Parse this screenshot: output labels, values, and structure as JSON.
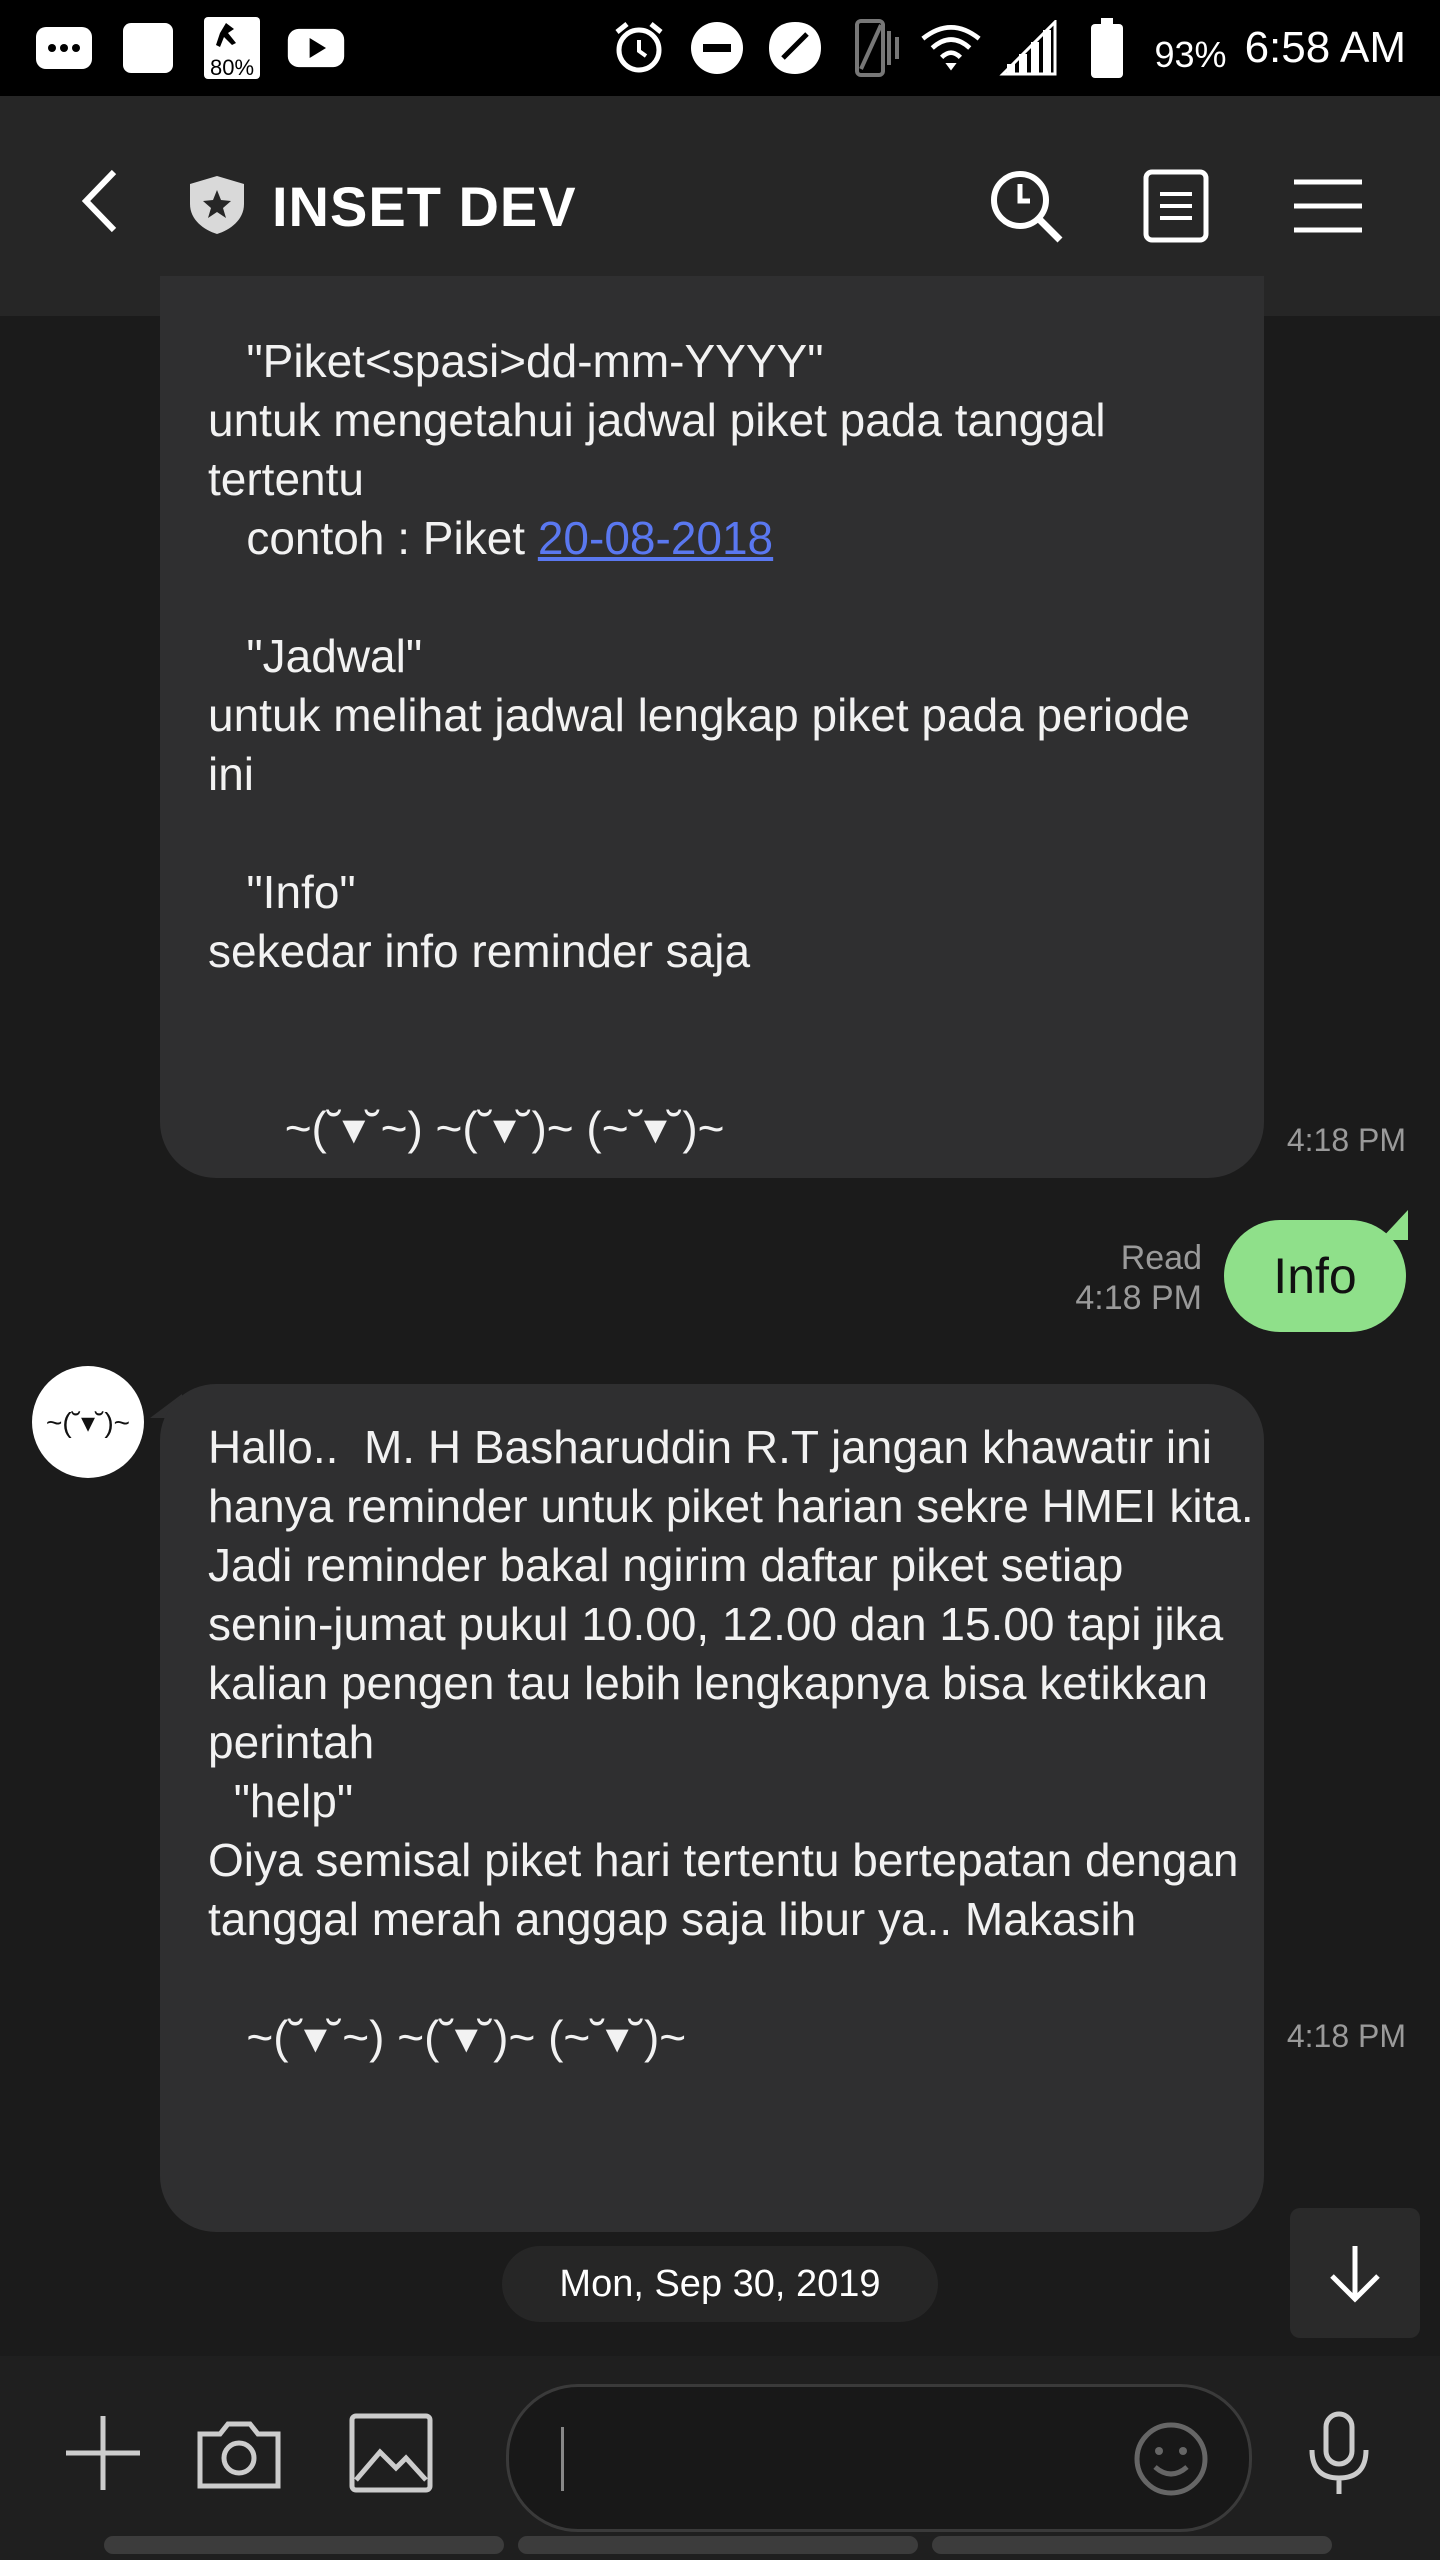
{
  "status_bar": {
    "battery_percent": "93%",
    "time": "6:58 AM",
    "left_icons": [
      "messages-icon",
      "square-app-icon",
      "data-80-icon",
      "youtube-icon"
    ],
    "right_icons": [
      "alarm-icon",
      "dnd-icon",
      "app-icon",
      "vibrate-icon",
      "wifi-icon",
      "signal-icon",
      "battery-icon"
    ],
    "data_badge": "80%"
  },
  "header": {
    "title": "INSET DEV",
    "back_icon": "chevron-left-icon",
    "badge_icon": "shield-star-icon",
    "actions": [
      "search-icon",
      "notes-icon",
      "menu-icon"
    ]
  },
  "messages": [
    {
      "direction": "incoming",
      "text_before_link": "   \"Piket<spasi>dd-mm-YYYY\"\nuntuk mengetahui jadwal piket pada tanggal tertentu\n   contoh : Piket ",
      "link": "20-08-2018",
      "text_after_link": "\n\n   \"Jadwal\"\nuntuk melihat jadwal lengkap piket pada periode ini\n\n   \"Info\"\nsekedar info reminder saja\n\n\n      ~(˘▾˘~) ~(˘▾˘)~ (~˘▾˘)~",
      "time": "4:18 PM"
    },
    {
      "direction": "outgoing",
      "text": "Info",
      "status": "Read",
      "time": "4:18 PM"
    },
    {
      "direction": "incoming",
      "avatar_text": "~(˘▾˘)~",
      "text": "Hallo..  M. H Basharuddin R.T jangan khawatir ini hanya reminder untuk piket harian sekre HMEI kita. Jadi reminder bakal ngirim daftar piket setiap senin-jumat pukul 10.00, 12.00 dan 15.00 tapi jika kalian pengen tau lebih lengkapnya bisa ketikkan perintah\n  \"help\"\nOiya semisal piket hari tertentu bertepatan dengan tanggal merah anggap saja libur ya.. Makasih\n\n   ~(˘▾˘~) ~(˘▾˘)~ (~˘▾˘)~",
      "time": "4:18 PM"
    }
  ],
  "date_separator": "Mon, Sep 30, 2019",
  "composer": {
    "placeholder": "",
    "icons": [
      "plus-icon",
      "camera-icon",
      "image-icon",
      "emoji-icon",
      "microphone-icon"
    ]
  },
  "colors": {
    "background": "#1b1b1b",
    "header": "#262626",
    "incoming_bubble": "#2f2f30",
    "outgoing_bubble": "#8fe08a",
    "link": "#5a78f0"
  }
}
